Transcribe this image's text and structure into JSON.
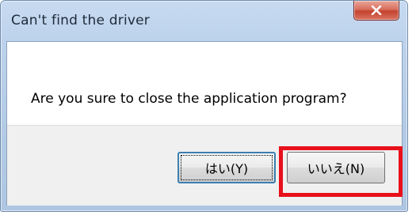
{
  "window": {
    "title": "Can't find the driver"
  },
  "dialog": {
    "message": "Are you sure to close the application program?"
  },
  "buttons": {
    "yes_label": "はい(Y)",
    "no_label": "いいえ(N)"
  },
  "icons": {
    "close": "close-icon"
  },
  "colors": {
    "highlight": "#e8101b",
    "close_button": "#c4432f",
    "titlebar": "#bcd2ec"
  }
}
